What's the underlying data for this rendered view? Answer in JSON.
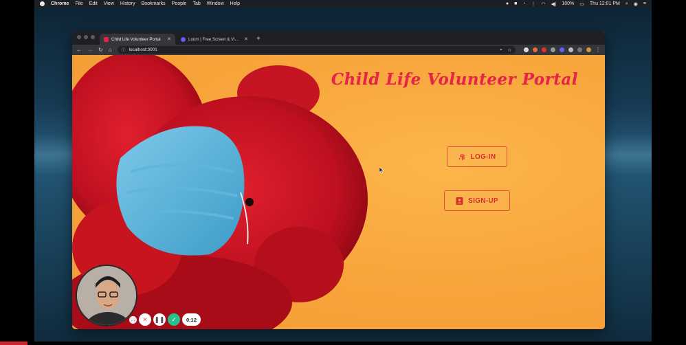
{
  "menubar": {
    "app": "Chrome",
    "items": [
      "File",
      "Edit",
      "View",
      "History",
      "Bookmarks",
      "People",
      "Tab",
      "Window",
      "Help"
    ],
    "battery": "100%",
    "clock": "Thu 12:01 PM"
  },
  "browser": {
    "tabs": [
      {
        "title": "Child Life Volunteer Portal",
        "active": true
      },
      {
        "title": "Loom | Free Screen & Video Re...",
        "active": false
      }
    ],
    "new_tab": "+",
    "url": "localhost:3001"
  },
  "page": {
    "title": "Child Life Volunteer Portal",
    "login_label": "LOG-IN",
    "signup_label": "SIGN-UP",
    "accent": "#e8234a",
    "background": "#f8a73d"
  },
  "loom": {
    "timer": "0:12",
    "more": "...",
    "cancel": "✕",
    "pause": "❚❚",
    "done": "✓"
  }
}
